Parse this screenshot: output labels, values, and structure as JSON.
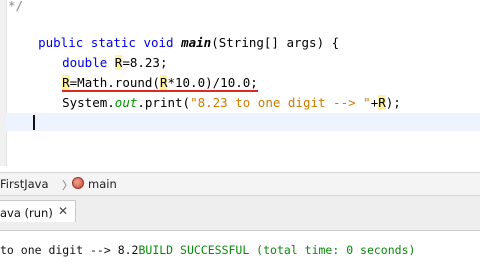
{
  "editor": {
    "comment_close": "*/",
    "line1": {
      "kw": "public static void",
      "method": "main",
      "rest": "(String[] args) {"
    },
    "line2": {
      "type": "double",
      "var": "R",
      "value": "=8.23;"
    },
    "line3": {
      "var": "R",
      "mid": "=Math.round(",
      "var2": "R",
      "rest": "*10.0)/10.0;"
    },
    "line4": {
      "prefix": "System.",
      "field": "out",
      "call": ".print(",
      "string": "\"8.23 to one digit --> \"",
      "plus": "+",
      "var": "R",
      "close": ");"
    }
  },
  "navigator": {
    "class_label": "FirstJava",
    "separator": "〉",
    "method_label": "main"
  },
  "output_panel": {
    "tab_label": "ava (run)",
    "close_symbol": "✕",
    "line_prefix": "to one digit --> 8.2",
    "build_text": "BUILD SUCCESSFUL (total time: 0 seconds)"
  },
  "icons": {
    "method_icon": "method-ball-icon",
    "close_icon": "close-icon"
  },
  "colors": {
    "keyword": "#0000e6",
    "string": "#ce7b00",
    "field": "#009900",
    "build_success": "#0a8a0a",
    "error_underline": "#e0281d",
    "highlight": "#fff3a1"
  }
}
